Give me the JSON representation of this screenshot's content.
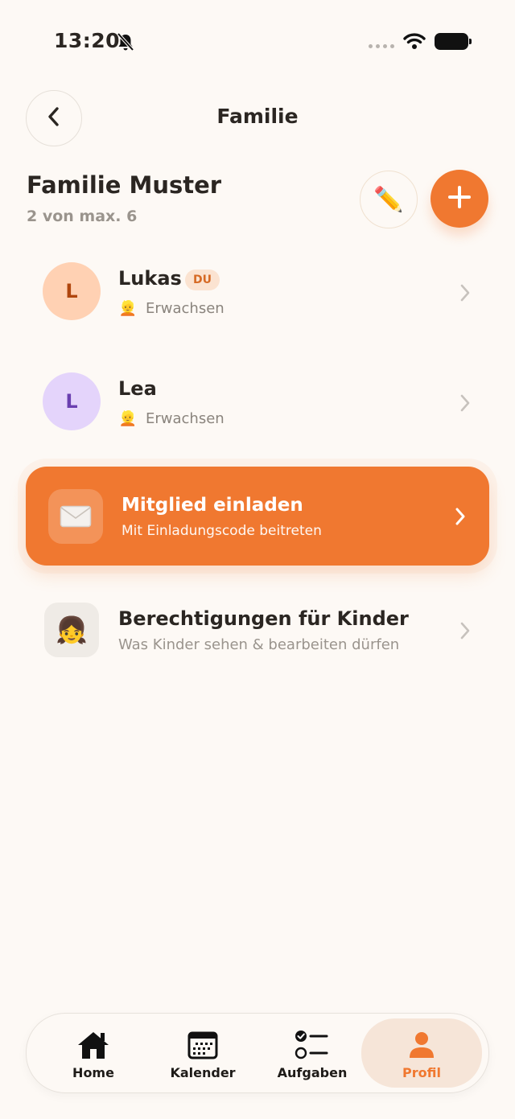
{
  "status_bar": {
    "time": "13:20"
  },
  "nav": {
    "title": "Familie"
  },
  "family": {
    "name": "Familie Muster",
    "count": "2 von max. 6"
  },
  "members": [
    {
      "initial": "L",
      "name": "Lukas",
      "badge": "DU",
      "role_emoji": "👱",
      "role": "Erwachsen",
      "avatar_bg": "#ffd1b3",
      "avatar_fg": "#b0460e"
    },
    {
      "initial": "L",
      "name": "Lea",
      "badge": "",
      "role_emoji": "👱",
      "role": "Erwachsen",
      "avatar_bg": "#e4d4fb",
      "avatar_fg": "#6a3fb0"
    }
  ],
  "invite": {
    "icon_emoji": "✉️",
    "title": "Mitglied einladen",
    "subtitle": "Mit Einladungscode beitreten"
  },
  "permissions": {
    "icon_emoji": "👧",
    "title": "Berechtigungen für Kinder",
    "subtitle": "Was Kinder sehen & bearbeiten dürfen"
  },
  "edit_emoji": "✏️",
  "tabs": [
    {
      "label": "Home",
      "icon": "home-icon",
      "active": false
    },
    {
      "label": "Kalender",
      "icon": "calendar-icon",
      "active": false
    },
    {
      "label": "Aufgaben",
      "icon": "tasks-icon",
      "active": false
    },
    {
      "label": "Profil",
      "icon": "profile-icon",
      "active": true
    }
  ],
  "colors": {
    "accent": "#f07830",
    "background": "#fdf9f5"
  }
}
